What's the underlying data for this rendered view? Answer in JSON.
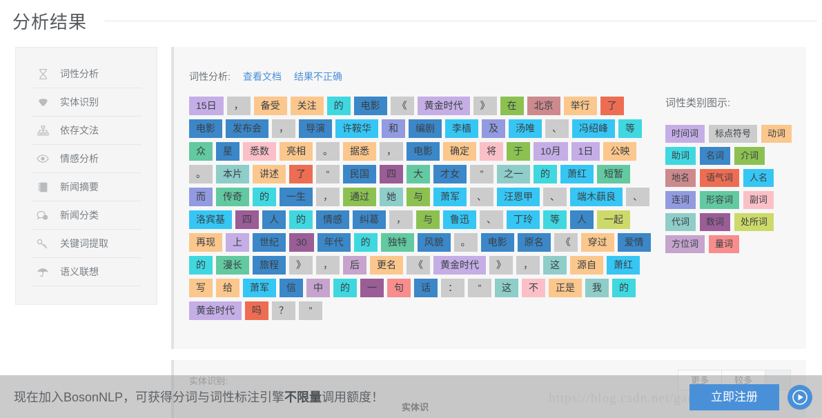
{
  "page": {
    "title": "分析结果"
  },
  "sidebar": {
    "items": [
      {
        "label": "词性分析",
        "icon": "hourglass-icon"
      },
      {
        "label": "实体识别",
        "icon": "bookmark-icon"
      },
      {
        "label": "依存文法",
        "icon": "sitemap-icon"
      },
      {
        "label": "情感分析",
        "icon": "eye-icon"
      },
      {
        "label": "新闻摘要",
        "icon": "notebook-icon"
      },
      {
        "label": "新闻分类",
        "icon": "comment-icon"
      },
      {
        "label": "关键词提取",
        "icon": "key-icon"
      },
      {
        "label": "语义联想",
        "icon": "umbrella-icon"
      }
    ]
  },
  "main": {
    "pos_header": {
      "label": "词性分析:",
      "doc_link": "查看文档",
      "wrong_link": "结果不正确"
    },
    "tokens": [
      {
        "text": "15日",
        "color": "#c5aee6"
      },
      {
        "text": "，",
        "color": "#cccccc"
      },
      {
        "text": "备受",
        "color": "#fbc78d"
      },
      {
        "text": "关注",
        "color": "#fbc78d"
      },
      {
        "text": "的",
        "color": "#3fd8e0"
      },
      {
        "text": "电影",
        "color": "#3b87c8"
      },
      {
        "text": "《",
        "color": "#cccccc"
      },
      {
        "text": "黄金时代",
        "color": "#c5aee6"
      },
      {
        "text": "》",
        "color": "#cccccc"
      },
      {
        "text": "在",
        "color": "#8cc152"
      },
      {
        "text": "北京",
        "color": "#cc8a8d"
      },
      {
        "text": "举行",
        "color": "#fbc78d"
      },
      {
        "text": "了",
        "color": "#ed6d52"
      },
      {
        "text": "电影",
        "color": "#3b87c8"
      },
      {
        "text": "发布会",
        "color": "#3b87c8"
      },
      {
        "text": "，",
        "color": "#cccccc"
      },
      {
        "text": "导演",
        "color": "#3b87c8"
      },
      {
        "text": "许鞍华",
        "color": "#36c6f4"
      },
      {
        "text": "和",
        "color": "#929ae0"
      },
      {
        "text": "编剧",
        "color": "#3b87c8"
      },
      {
        "text": "李樯",
        "color": "#36c6f4"
      },
      {
        "text": "及",
        "color": "#929ae0"
      },
      {
        "text": "汤唯",
        "color": "#36c6f4"
      },
      {
        "text": "、",
        "color": "#cccccc"
      },
      {
        "text": "冯绍峰",
        "color": "#36c6f4"
      },
      {
        "text": "等",
        "color": "#3fd8e0"
      },
      {
        "text": "众",
        "color": "#62c9a0"
      },
      {
        "text": "星",
        "color": "#3b87c8"
      },
      {
        "text": "悉数",
        "color": "#fbc0c7"
      },
      {
        "text": "亮相",
        "color": "#fbc78d"
      },
      {
        "text": "。",
        "color": "#cccccc"
      },
      {
        "text": "据悉",
        "color": "#fbc78d"
      },
      {
        "text": "，",
        "color": "#cccccc"
      },
      {
        "text": "电影",
        "color": "#3b87c8"
      },
      {
        "text": "确定",
        "color": "#fbc78d"
      },
      {
        "text": "将",
        "color": "#fbc0c7"
      },
      {
        "text": "于",
        "color": "#8cc152"
      },
      {
        "text": "10月",
        "color": "#c5aee6"
      },
      {
        "text": "1日",
        "color": "#c5aee6"
      },
      {
        "text": "公映",
        "color": "#fbc78d"
      },
      {
        "text": "。",
        "color": "#cccccc"
      },
      {
        "text": "本片",
        "color": "#8fcdc9"
      },
      {
        "text": "讲述",
        "color": "#fbc78d"
      },
      {
        "text": "了",
        "color": "#ed6d52"
      },
      {
        "text": "“",
        "color": "#cccccc"
      },
      {
        "text": "民国",
        "color": "#3b87c8"
      },
      {
        "text": "四",
        "color": "#9a5d96"
      },
      {
        "text": "大",
        "color": "#62c9a0"
      },
      {
        "text": "才女",
        "color": "#3b87c8"
      },
      {
        "text": "”",
        "color": "#cccccc"
      },
      {
        "text": "之一",
        "color": "#8fcdc9"
      },
      {
        "text": "的",
        "color": "#3fd8e0"
      },
      {
        "text": "萧红",
        "color": "#36c6f4"
      },
      {
        "text": "短暂",
        "color": "#62c9a0"
      },
      {
        "text": "而",
        "color": "#929ae0"
      },
      {
        "text": "传奇",
        "color": "#62c9a0"
      },
      {
        "text": "的",
        "color": "#3fd8e0"
      },
      {
        "text": "一生",
        "color": "#3b87c8"
      },
      {
        "text": "，",
        "color": "#cccccc"
      },
      {
        "text": "通过",
        "color": "#8cc152"
      },
      {
        "text": "她",
        "color": "#8fcdc9"
      },
      {
        "text": "与",
        "color": "#8cc152"
      },
      {
        "text": "萧军",
        "color": "#36c6f4"
      },
      {
        "text": "、",
        "color": "#cccccc"
      },
      {
        "text": "汪恩甲",
        "color": "#36c6f4"
      },
      {
        "text": "、",
        "color": "#cccccc"
      },
      {
        "text": "端木蕻良",
        "color": "#36c6f4"
      },
      {
        "text": "、",
        "color": "#cccccc"
      },
      {
        "text": "洛宾基",
        "color": "#36c6f4"
      },
      {
        "text": "四",
        "color": "#9a5d96"
      },
      {
        "text": "人",
        "color": "#3b87c8"
      },
      {
        "text": "的",
        "color": "#3fd8e0"
      },
      {
        "text": "情感",
        "color": "#3b87c8"
      },
      {
        "text": "纠葛",
        "color": "#3b87c8"
      },
      {
        "text": "，",
        "color": "#cccccc"
      },
      {
        "text": "与",
        "color": "#8cc152"
      },
      {
        "text": "鲁迅",
        "color": "#36c6f4"
      },
      {
        "text": "、",
        "color": "#cccccc"
      },
      {
        "text": "丁玲",
        "color": "#36c6f4"
      },
      {
        "text": "等",
        "color": "#3fd8e0"
      },
      {
        "text": "人",
        "color": "#3b87c8"
      },
      {
        "text": "一起",
        "color": "#cdda6a"
      },
      {
        "text": "再现",
        "color": "#fbc78d"
      },
      {
        "text": "上",
        "color": "#c5aee6"
      },
      {
        "text": "世纪",
        "color": "#3b87c8"
      },
      {
        "text": "30",
        "color": "#9a5d96"
      },
      {
        "text": "年代",
        "color": "#3b87c8"
      },
      {
        "text": "的",
        "color": "#3fd8e0"
      },
      {
        "text": "独特",
        "color": "#62c9a0"
      },
      {
        "text": "风貌",
        "color": "#3b87c8"
      },
      {
        "text": "。",
        "color": "#cccccc"
      },
      {
        "text": "电影",
        "color": "#3b87c8"
      },
      {
        "text": "原名",
        "color": "#3b87c8"
      },
      {
        "text": "《",
        "color": "#cccccc"
      },
      {
        "text": "穿过",
        "color": "#fbc78d"
      },
      {
        "text": "爱情",
        "color": "#3b87c8"
      },
      {
        "text": "的",
        "color": "#3fd8e0"
      },
      {
        "text": "漫长",
        "color": "#62c9a0"
      },
      {
        "text": "旅程",
        "color": "#3b87c8"
      },
      {
        "text": "》",
        "color": "#cccccc"
      },
      {
        "text": "，",
        "color": "#cccccc"
      },
      {
        "text": "后",
        "color": "#c6a4cd"
      },
      {
        "text": "更名",
        "color": "#fbc78d"
      },
      {
        "text": "《",
        "color": "#cccccc"
      },
      {
        "text": "黄金时代",
        "color": "#c5aee6"
      },
      {
        "text": "》",
        "color": "#cccccc"
      },
      {
        "text": "，",
        "color": "#cccccc"
      },
      {
        "text": "这",
        "color": "#8fcdc9"
      },
      {
        "text": "源自",
        "color": "#fbc78d"
      },
      {
        "text": "萧红",
        "color": "#36c6f4"
      },
      {
        "text": "写",
        "color": "#fbc78d"
      },
      {
        "text": "给",
        "color": "#fbc78d"
      },
      {
        "text": "萧军",
        "color": "#36c6f4"
      },
      {
        "text": "信",
        "color": "#3b87c8"
      },
      {
        "text": "中",
        "color": "#c6a4cd"
      },
      {
        "text": "的",
        "color": "#3fd8e0"
      },
      {
        "text": "一",
        "color": "#9a5d96"
      },
      {
        "text": "句",
        "color": "#f78d8d"
      },
      {
        "text": "话",
        "color": "#3b87c8"
      },
      {
        "text": "：",
        "color": "#cccccc"
      },
      {
        "text": "“",
        "color": "#cccccc"
      },
      {
        "text": "这",
        "color": "#8fcdc9"
      },
      {
        "text": "不",
        "color": "#fbc0c7"
      },
      {
        "text": "正是",
        "color": "#fbc78d"
      },
      {
        "text": "我",
        "color": "#8fcdc9"
      },
      {
        "text": "的",
        "color": "#3fd8e0"
      },
      {
        "text": "黄金时代",
        "color": "#c5aee6"
      },
      {
        "text": "吗",
        "color": "#ed6d52"
      },
      {
        "text": "？",
        "color": "#cccccc"
      },
      {
        "text": "”",
        "color": "#cccccc"
      }
    ],
    "legend": {
      "title": "词性类别图示:",
      "chips": [
        {
          "label": "时间词",
          "color": "#c5aee6"
        },
        {
          "label": "标点符号",
          "color": "#cccccc"
        },
        {
          "label": "动词",
          "color": "#fbc78d"
        },
        {
          "label": "助词",
          "color": "#3fd8e0"
        },
        {
          "label": "名词",
          "color": "#3b87c8"
        },
        {
          "label": "介词",
          "color": "#8cc152"
        },
        {
          "label": "地名",
          "color": "#cc8a8d"
        },
        {
          "label": "语气词",
          "color": "#ed6d52"
        },
        {
          "label": "人名",
          "color": "#36c6f4"
        },
        {
          "label": "连词",
          "color": "#929ae0"
        },
        {
          "label": "形容词",
          "color": "#62c9a0"
        },
        {
          "label": "副词",
          "color": "#fbc0c7"
        },
        {
          "label": "代词",
          "color": "#8fcdc9"
        },
        {
          "label": "数词",
          "color": "#9a5d96"
        },
        {
          "label": "处所词",
          "color": "#cdda6a"
        },
        {
          "label": "方位词",
          "color": "#c6a4cd"
        },
        {
          "label": "量词",
          "color": "#f78d8d"
        }
      ]
    }
  },
  "lower": {
    "label": "实体识别:",
    "sub_label": "实体识",
    "buttons": [
      {
        "label": "更多",
        "active": false
      },
      {
        "label": "较多",
        "active": false
      },
      {
        "label": "",
        "active": true
      }
    ]
  },
  "watermark": {
    "text": "https://blog.csdn.net/gaotzen_xian"
  },
  "promo": {
    "text_before": "现在加入BosonNLP，可获得分词与词性标注引擎",
    "text_bold": "不限量",
    "text_after": "调用额度！",
    "cta": "立即注册",
    "play_icon": "play-icon"
  },
  "colors": {
    "accent": "#4a90d9",
    "panel_bg": "#f7f7f7",
    "sidebar_bg": "#f5f5f5"
  }
}
